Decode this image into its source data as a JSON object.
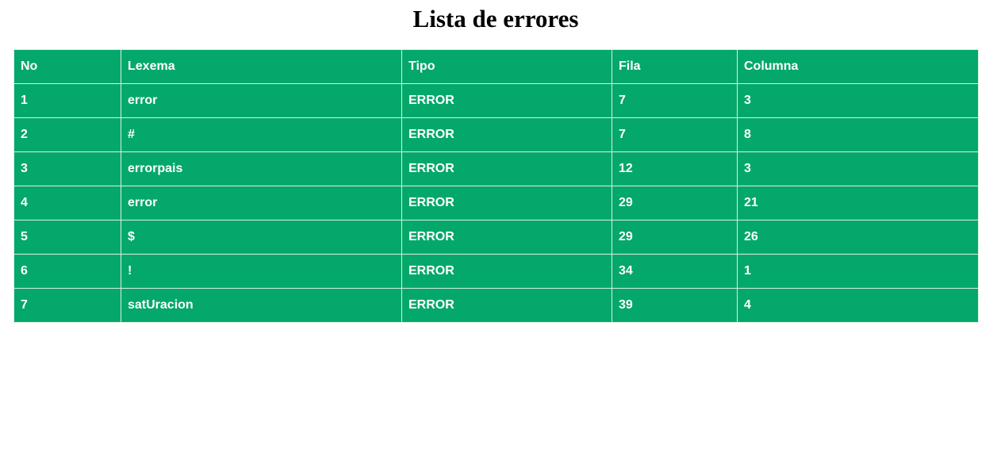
{
  "page": {
    "title": "Lista de errores"
  },
  "colors": {
    "table_background": "#04a86a",
    "table_text": "#ffffff",
    "cell_border": "#d9efe6"
  },
  "table": {
    "headers": [
      "No",
      "Lexema",
      "Tipo",
      "Fila",
      "Columna"
    ],
    "rows": [
      [
        "1",
        "error",
        "ERROR",
        "7",
        "3"
      ],
      [
        "2",
        "#",
        "ERROR",
        "7",
        "8"
      ],
      [
        "3",
        "errorpais",
        "ERROR",
        "12",
        "3"
      ],
      [
        "4",
        "error",
        "ERROR",
        "29",
        "21"
      ],
      [
        "5",
        "$",
        "ERROR",
        "29",
        "26"
      ],
      [
        "6",
        "!",
        "ERROR",
        "34",
        "1"
      ],
      [
        "7",
        "satUracion",
        "ERROR",
        "39",
        "4"
      ]
    ]
  }
}
